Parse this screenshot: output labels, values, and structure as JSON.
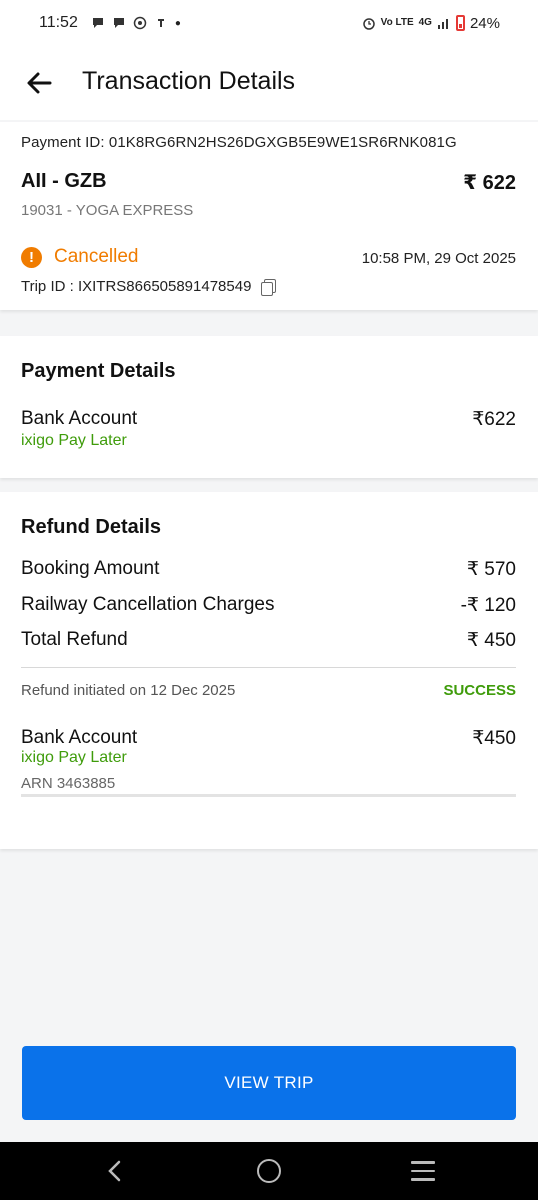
{
  "status_bar": {
    "time": "11:52",
    "network_volte": "Vo LTE",
    "network_type": "4G",
    "battery": "24%"
  },
  "header": {
    "title": "Transaction Details"
  },
  "transaction": {
    "payment_id": "Payment ID:  01K8RG6RN2HS26DGXGB5E9WE1SR6RNK081G",
    "route": "AII - GZB",
    "amount": "₹ 622",
    "train": "19031 - YOGA EXPRESS",
    "status": "Cancelled",
    "datetime": "10:58 PM, 29 Oct 2025",
    "trip_id": "Trip ID :  IXITRS866505891478549"
  },
  "payment_details": {
    "title": "Payment Details",
    "method": "Bank Account",
    "method_sub": "ixigo Pay Later",
    "amount": "₹622"
  },
  "refund_details": {
    "title": "Refund Details",
    "rows": [
      {
        "label": "Booking Amount",
        "value": "₹ 570"
      },
      {
        "label": "Railway Cancellation Charges",
        "value": "-₹ 120"
      },
      {
        "label": "Total Refund",
        "value": "₹ 450"
      }
    ],
    "initiated": "Refund initiated on 12 Dec 2025",
    "refund_status": "SUCCESS",
    "method": "Bank Account",
    "method_sub": "ixigo Pay Later",
    "amount": "₹450",
    "arn": "ARN 3463885"
  },
  "actions": {
    "view_trip": "VIEW TRIP"
  },
  "colors": {
    "accent": "#0a72ea",
    "warning": "#f07c00",
    "success": "#3f9c0b"
  }
}
